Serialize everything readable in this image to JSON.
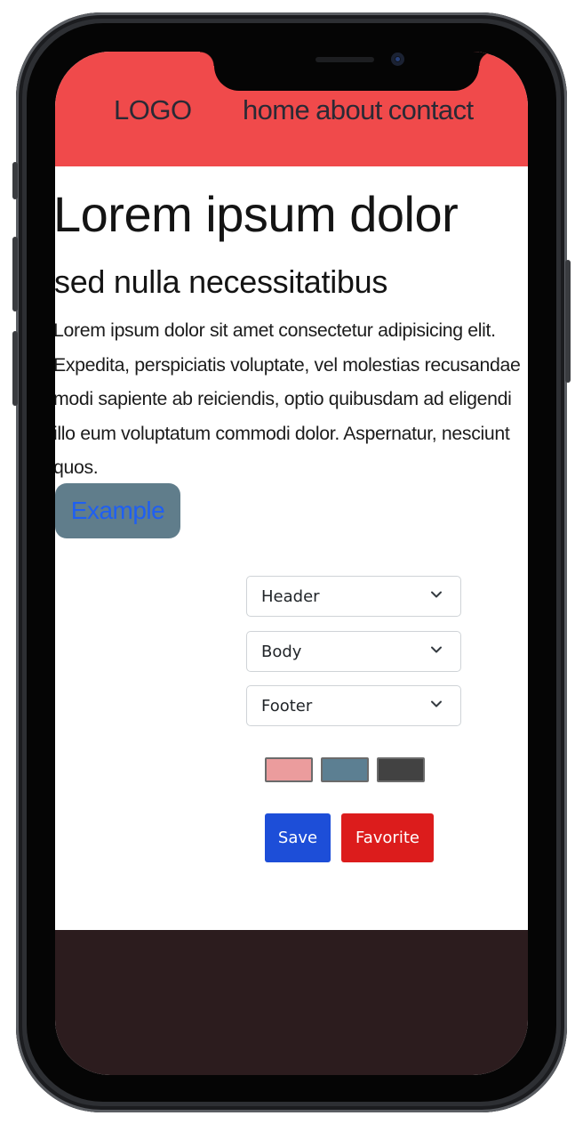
{
  "header": {
    "logo": "LOGO",
    "nav": [
      "home",
      "about",
      "contact"
    ],
    "background": "#f04a4b"
  },
  "hero": {
    "title": "Lorem ipsum dolor",
    "subtitle": "sed nulla necessitatibus",
    "body": "Lorem ipsum dolor sit amet consectetur adipisicing elit. Expedita, perspiciatis voluptate, vel molestias recusandae modi sapiente ab reiciendis, optio quibusdam ad eligendi illo eum voluptatum commodi dolor. Aspernatur, nesciunt quos.",
    "button_label": "Example",
    "button_background": "#607d8b",
    "button_text_color": "#1f5ff2"
  },
  "selects": [
    {
      "value": "Header",
      "icon": "chevron-down-icon"
    },
    {
      "value": "Body",
      "icon": "chevron-down-icon"
    },
    {
      "value": "Footer",
      "icon": "chevron-down-icon"
    }
  ],
  "swatches": [
    {
      "color": "#eb9c9d"
    },
    {
      "color": "#5c7f92"
    },
    {
      "color": "#424242"
    }
  ],
  "actions": {
    "save": {
      "label": "Save",
      "color": "#1d4ed8"
    },
    "favorite": {
      "label": "Favorite",
      "color": "#dc1c1c"
    }
  },
  "footer": {
    "background": "#2c1c1e"
  }
}
